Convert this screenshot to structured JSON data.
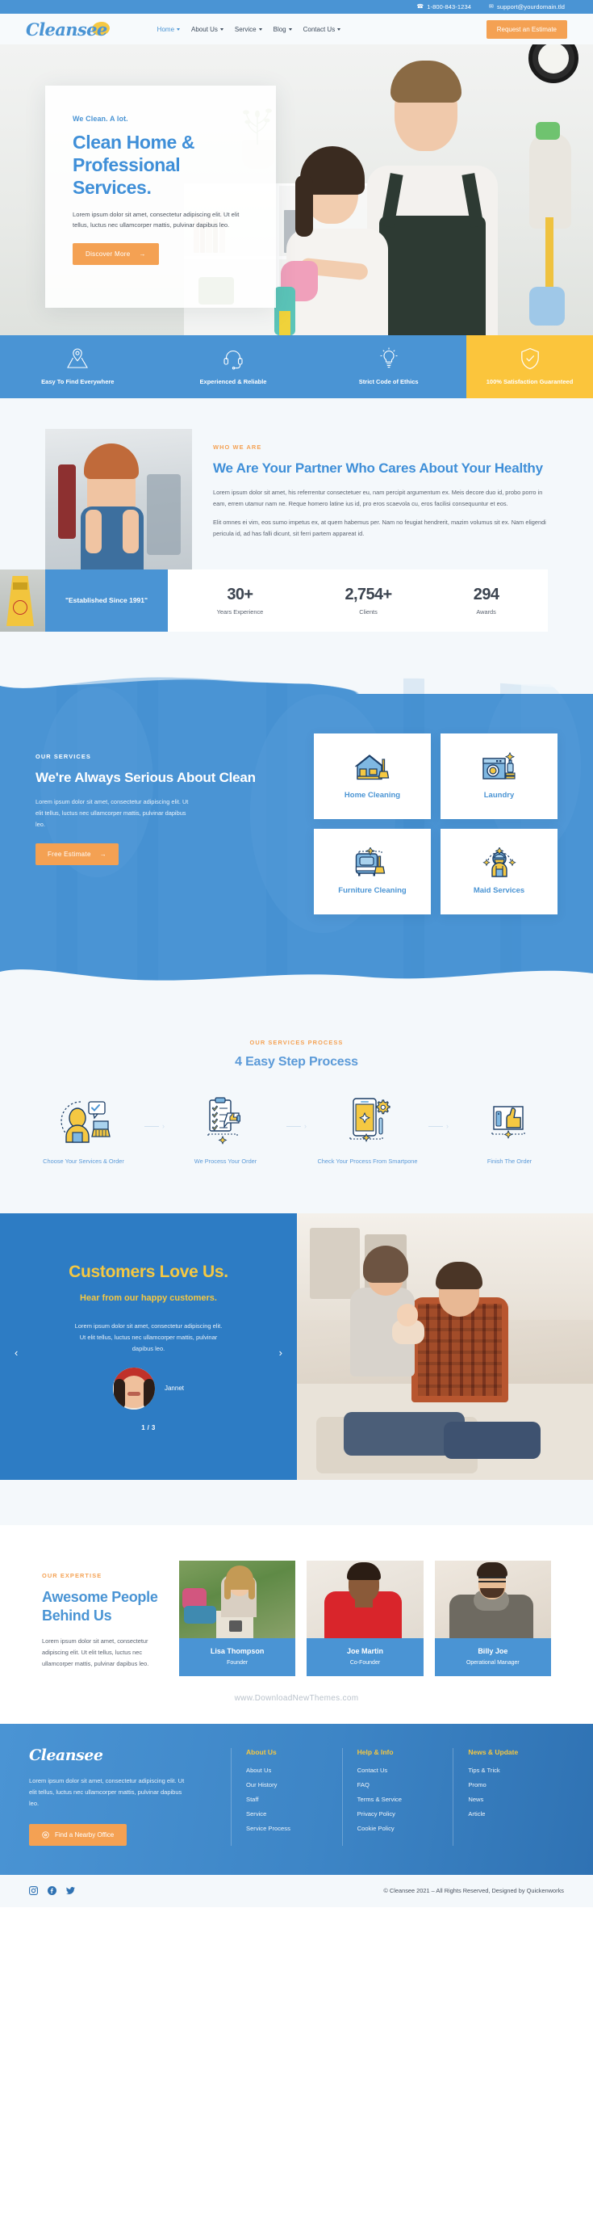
{
  "topbar": {
    "phone": "1-800-843-1234",
    "email": "support@yourdomain.tld",
    "phone_icon": "phone-icon",
    "mail_icon": "mail-icon"
  },
  "header": {
    "logo": "Cleansee",
    "nav": [
      {
        "label": "Home",
        "active": true,
        "caret": true
      },
      {
        "label": "About Us",
        "active": false,
        "caret": true
      },
      {
        "label": "Service",
        "active": false,
        "caret": true
      },
      {
        "label": "Blog",
        "active": false,
        "caret": true
      },
      {
        "label": "Contact Us",
        "active": false,
        "caret": true
      }
    ],
    "cta": "Request an Estimate"
  },
  "hero": {
    "kicker": "We Clean. A lot.",
    "title": "Clean Home & Professional Services.",
    "desc": "Lorem ipsum dolor sit amet, consectetur adipiscing elit. Ut elit tellus, luctus nec ullamcorper mattis, pulvinar dapibus leo.",
    "button": "Discover More"
  },
  "features": [
    {
      "label": "Easy To Find Everywhere",
      "icon": "map-pin-icon",
      "highlight": false
    },
    {
      "label": "Experienced & Reliable",
      "icon": "headset-icon",
      "highlight": false
    },
    {
      "label": "Strict Code of Ethics",
      "icon": "lightbulb-icon",
      "highlight": false
    },
    {
      "label": "100% Satisfaction Guaranteed",
      "icon": "shield-check-icon",
      "highlight": true
    }
  ],
  "about": {
    "kicker": "WHO WE ARE",
    "title": "We Are Your Partner Who Cares About Your Healthy",
    "p1": "Lorem ipsum dolor sit amet, his referrentur consectetuer eu, nam percipit argumentum ex. Meis decore duo id, probo porro in eam, errem utamur nam ne. Reque homero latine ius id, pro eros scaevola cu, eros facilisi consequuntur et eos.",
    "p2": "Elit omnes ei vim, eos sumo impetus ex, at quem habemus per. Nam no feugiat hendrerit, mazim volumus sit ex. Nam eligendi pericula id, ad has falli dicunt, sit ferri partem appareat id.",
    "badge": "\"Established Since 1991\"",
    "stats": [
      {
        "num": "30+",
        "cap": "Years Experience"
      },
      {
        "num": "2,754+",
        "cap": "Clients"
      },
      {
        "num": "294",
        "cap": "Awards"
      }
    ]
  },
  "services": {
    "kicker": "OUR SERVICES",
    "title": "We're Always Serious About Clean",
    "desc": "Lorem ipsum dolor sit amet, consectetur adipiscing elit. Ut elit tellus, luctus nec ullamcorper mattis, pulvinar dapibus leo.",
    "button": "Free Estimate",
    "cards": [
      {
        "title": "Home Cleaning",
        "icon": "house-broom-icon"
      },
      {
        "title": "Laundry",
        "icon": "washing-machine-icon"
      },
      {
        "title": "Furniture Cleaning",
        "icon": "sofa-broom-icon"
      },
      {
        "title": "Maid Services",
        "icon": "maid-icon"
      }
    ]
  },
  "process": {
    "kicker": "OUR SERVICES PROCESS",
    "title": "4 Easy Step Process",
    "steps": [
      {
        "label": "Choose Your Services & Order",
        "icon": "person-choose-icon"
      },
      {
        "label": "We Process Your Order",
        "icon": "clipboard-thumbsup-icon"
      },
      {
        "label": "Check Your Process From Smartpone",
        "icon": "smartphone-gear-icon"
      },
      {
        "label": "Finish The Order",
        "icon": "thumbsup-card-icon"
      }
    ]
  },
  "testimonial": {
    "title": "Customers Love Us.",
    "subtitle": "Hear from our happy customers.",
    "quote": "Lorem ipsum dolor sit amet, consectetur adipiscing elit. Ut elit tellus, luctus nec ullamcorper mattis, pulvinar dapibus leo.",
    "name": "Jannet",
    "counter": "1 / 3",
    "prev": "‹",
    "next": "›"
  },
  "team": {
    "kicker": "OUR EXPERTISE",
    "title": "Awesome People Behind Us",
    "desc": "Lorem ipsum dolor sit amet, consectetur adipiscing elit. Ut elit tellus, luctus nec ullamcorper mattis, pulvinar dapibus leo.",
    "members": [
      {
        "name": "Lisa Thompson",
        "role": "Founder"
      },
      {
        "name": "Joe Martin",
        "role": "Co-Founder"
      },
      {
        "name": "Billy Joe",
        "role": "Operational Manager"
      }
    ]
  },
  "watermark": "www.DownloadNewThemes.com",
  "footer": {
    "logo": "Cleansee",
    "desc": "Lorem ipsum dolor sit amet, consectetur adipiscing elit. Ut elit tellus, luctus nec ullamcorper mattis, pulvinar dapibus leo.",
    "button": "Find a Nearby Office",
    "button_icon": "location-pin-icon",
    "columns": [
      {
        "title": "About Us",
        "links": [
          "About Us",
          "Our History",
          "Staff",
          "Service",
          "Service Process"
        ]
      },
      {
        "title": "Help & Info",
        "links": [
          "Contact Us",
          "FAQ",
          "Terms & Service",
          "Privacy Policy",
          "Cookie Policy"
        ]
      },
      {
        "title": "News & Update",
        "links": [
          "Tips & Trick",
          "Promo",
          "News",
          "Article"
        ]
      }
    ],
    "socials": [
      "instagram-icon",
      "facebook-icon",
      "twitter-icon"
    ],
    "copyright": "© Cleansee 2021 – All Rights Reserved, Designed by Quickenworks"
  },
  "colors": {
    "brand_blue": "#4a94d4",
    "deep_blue": "#2d7cc4",
    "accent_orange": "#f4a153",
    "accent_yellow": "#f5c842",
    "highlight_yellow": "#fbc53c",
    "page_bg": "#f4f8fb"
  }
}
